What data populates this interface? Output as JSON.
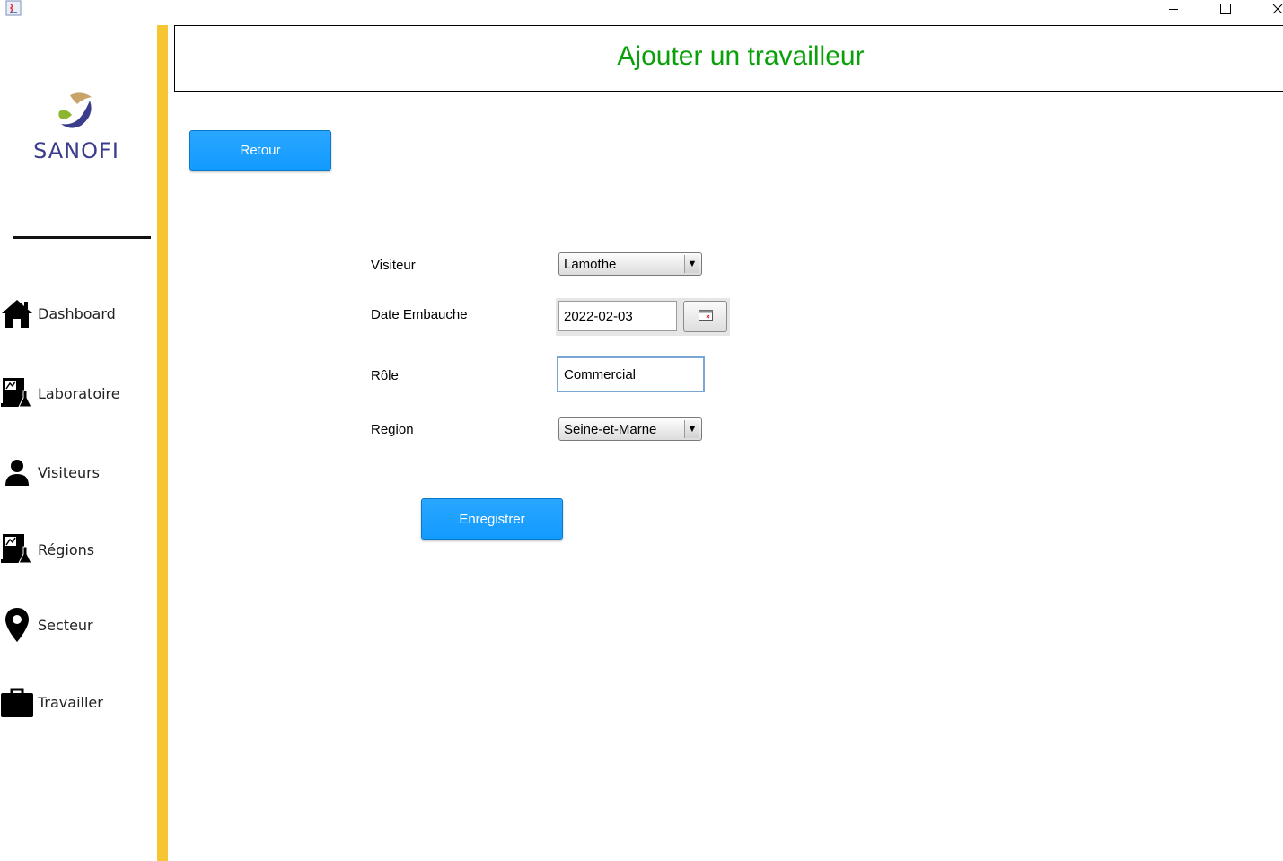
{
  "window": {
    "app_icon": "java-cup-icon",
    "minimize_glyph": "—",
    "maximize_glyph": "☐",
    "close_glyph": "✕"
  },
  "brand": {
    "name": "SANOFI",
    "logo_icon": "sanofi-logo",
    "accent_color": "#f5c632"
  },
  "sidebar": {
    "items": [
      {
        "label": "Dashboard",
        "icon": "home-icon"
      },
      {
        "label": "Laboratoire",
        "icon": "laboratory-icon"
      },
      {
        "label": "Visiteurs",
        "icon": "user-icon"
      },
      {
        "label": "Régions",
        "icon": "laboratory-icon"
      },
      {
        "label": "Secteur",
        "icon": "map-pin-icon"
      },
      {
        "label": "Travailler",
        "icon": "briefcase-icon"
      }
    ]
  },
  "header": {
    "title": "Ajouter un travailleur",
    "title_color": "#0aa00a"
  },
  "buttons": {
    "back": "Retour",
    "save": "Enregistrer",
    "button_color": "#1a9fff"
  },
  "form": {
    "visiteur": {
      "label": "Visiteur",
      "value": "Lamothe"
    },
    "date": {
      "label": "Date Embauche",
      "value": "2022-02-03",
      "picker_icon": "calendar-icon"
    },
    "role": {
      "label": "Rôle",
      "value": "Commercial"
    },
    "region": {
      "label": "Region",
      "value": "Seine-et-Marne"
    }
  }
}
